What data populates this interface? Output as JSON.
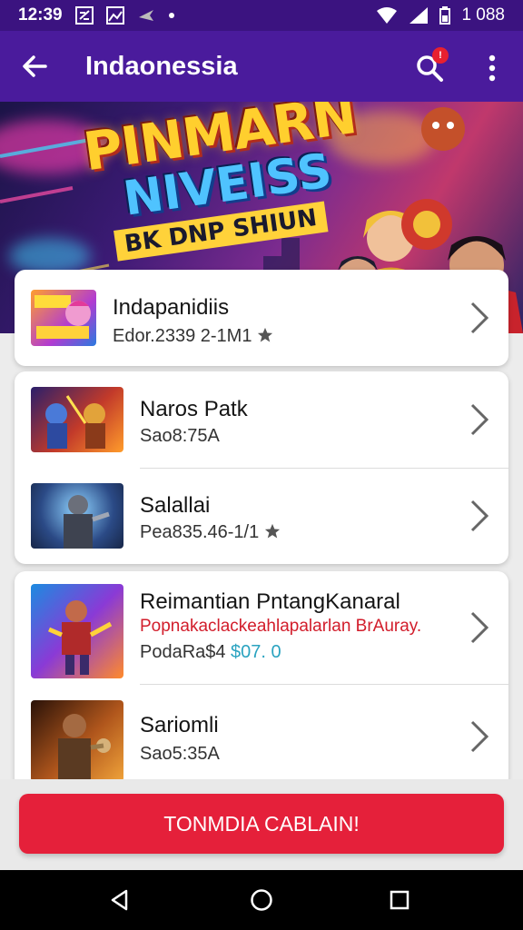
{
  "status_bar": {
    "time": "12:39",
    "battery": "1 088",
    "icons": [
      "notification-box-icon",
      "image-notification-icon",
      "airplane-icon",
      "dot-icon",
      "wifi-icon",
      "signal-icon",
      "battery-icon"
    ]
  },
  "app_bar": {
    "title": "Indaonessia",
    "search_badge": "!",
    "icons": [
      "back-arrow-icon",
      "search-icon",
      "more-vert-icon"
    ]
  },
  "banner": {
    "line1": "PINMARN",
    "line2": "NIVEISS",
    "line3": "BK DNP SHIUN"
  },
  "list": {
    "card1": {
      "row1": {
        "title": "Indapanidiis",
        "subtitle": "Edor.2339 2-1M1",
        "rating_icon": "star-icon"
      }
    },
    "card2": {
      "row1": {
        "title": "Naros Patk",
        "subtitle": "Sao8:75A"
      },
      "row2": {
        "title": "Salallai",
        "subtitle": "Pea835.46-1/1",
        "rating_icon": "star-icon"
      }
    },
    "card3": {
      "row1": {
        "title": "Reimantian PntangKanaral",
        "tagline": "Popnakaclackeahlapalarlan BrAuray.",
        "subtitle": "PodaRa$4",
        "price": "$07. 0"
      },
      "row2": {
        "title": "Sariomli",
        "subtitle": "Sao5:35A"
      }
    }
  },
  "cta": {
    "label": "TONMDIA CABLAIN!"
  },
  "colors": {
    "app_bar": "#4a1b9c",
    "status_bar": "#3b1380",
    "cta": "#e5203a",
    "price": "#2aa3c0",
    "tagline": "#d21d2b"
  },
  "nav_bar": {
    "icons": [
      "back-triangle-icon",
      "home-circle-icon",
      "recents-square-icon"
    ]
  }
}
